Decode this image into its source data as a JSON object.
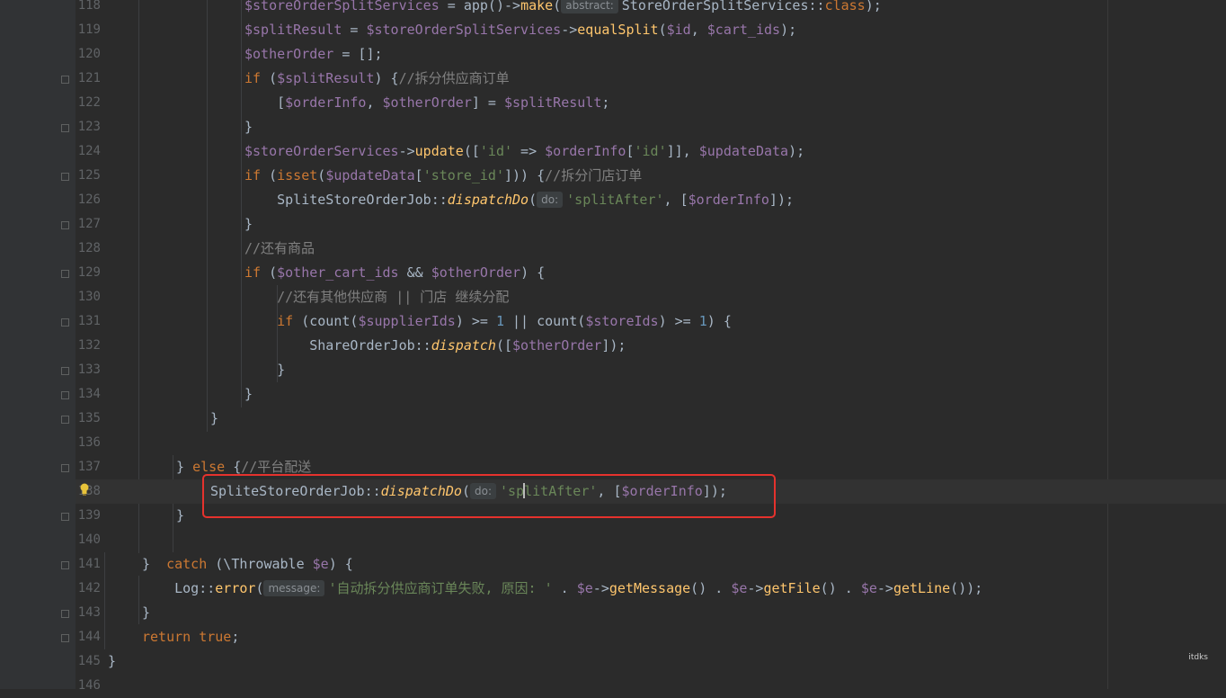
{
  "editor": {
    "lines": [
      {
        "n": "118",
        "segments": [
          [
            "var",
            "$storeOrderSplitServices"
          ],
          [
            "p",
            " = app()->"
          ],
          [
            "fn",
            "make"
          ],
          [
            "p",
            "("
          ],
          [
            "hint",
            "abstract:"
          ],
          [
            "p",
            "StoreOrderSplitServices::"
          ],
          [
            "kw",
            "class"
          ],
          [
            "p",
            ");"
          ]
        ]
      },
      {
        "n": "119",
        "segments": [
          [
            "var",
            "$splitResult"
          ],
          [
            "p",
            " = "
          ],
          [
            "var",
            "$storeOrderSplitServices"
          ],
          [
            "p",
            "->"
          ],
          [
            "fn",
            "equalSplit"
          ],
          [
            "p",
            "("
          ],
          [
            "var",
            "$id"
          ],
          [
            "p",
            ", "
          ],
          [
            "var",
            "$cart_ids"
          ],
          [
            "p",
            ");"
          ]
        ]
      },
      {
        "n": "120",
        "segments": [
          [
            "var",
            "$otherOrder"
          ],
          [
            "p",
            " = [];"
          ]
        ]
      },
      {
        "n": "121",
        "segments": [
          [
            "kw",
            "if"
          ],
          [
            "p",
            " ("
          ],
          [
            "var",
            "$splitResult"
          ],
          [
            "p",
            ") {"
          ],
          [
            "cm",
            "//拆分供应商订单"
          ]
        ]
      },
      {
        "n": "122",
        "segments": [
          [
            "p",
            "    ["
          ],
          [
            "var",
            "$orderInfo"
          ],
          [
            "p",
            ", "
          ],
          [
            "var",
            "$otherOrder"
          ],
          [
            "p",
            "] = "
          ],
          [
            "var",
            "$splitResult"
          ],
          [
            "p",
            ";"
          ]
        ]
      },
      {
        "n": "123",
        "segments": [
          [
            "p",
            "}"
          ]
        ]
      },
      {
        "n": "124",
        "segments": [
          [
            "var",
            "$storeOrderServices"
          ],
          [
            "p",
            "->"
          ],
          [
            "fn",
            "update"
          ],
          [
            "p",
            "(["
          ],
          [
            "str",
            "'id'"
          ],
          [
            "p",
            " => "
          ],
          [
            "var",
            "$orderInfo"
          ],
          [
            "p",
            "["
          ],
          [
            "str",
            "'id'"
          ],
          [
            "p",
            "]], "
          ],
          [
            "var",
            "$updateData"
          ],
          [
            "p",
            ");"
          ]
        ]
      },
      {
        "n": "125",
        "segments": [
          [
            "kw",
            "if"
          ],
          [
            "p",
            " ("
          ],
          [
            "kw",
            "isset"
          ],
          [
            "p",
            "("
          ],
          [
            "var",
            "$updateData"
          ],
          [
            "p",
            "["
          ],
          [
            "str",
            "'store_id'"
          ],
          [
            "p",
            "])) {"
          ],
          [
            "cm",
            "//拆分门店订单"
          ]
        ]
      },
      {
        "n": "126",
        "segments": [
          [
            "p",
            "    SpliteStoreOrderJob::"
          ],
          [
            "sfn",
            "dispatchDo"
          ],
          [
            "p",
            "("
          ],
          [
            "hint",
            "do:"
          ],
          [
            "str",
            "'splitAfter'"
          ],
          [
            "p",
            ", ["
          ],
          [
            "var",
            "$orderInfo"
          ],
          [
            "p",
            "]);"
          ]
        ]
      },
      {
        "n": "127",
        "segments": [
          [
            "p",
            "}"
          ]
        ]
      },
      {
        "n": "128",
        "segments": [
          [
            "cm",
            "//还有商品"
          ]
        ]
      },
      {
        "n": "129",
        "segments": [
          [
            "kw",
            "if"
          ],
          [
            "p",
            " ("
          ],
          [
            "var",
            "$other_cart_ids"
          ],
          [
            "p",
            " && "
          ],
          [
            "var",
            "$otherOrder"
          ],
          [
            "p",
            ") {"
          ]
        ]
      },
      {
        "n": "130",
        "segments": [
          [
            "cm",
            "    //还有其他供应商 || 门店 继续分配"
          ]
        ]
      },
      {
        "n": "131",
        "segments": [
          [
            "p",
            "    "
          ],
          [
            "kw",
            "if"
          ],
          [
            "p",
            " (count("
          ],
          [
            "var",
            "$supplierIds"
          ],
          [
            "p",
            ") >= "
          ],
          [
            "num",
            "1"
          ],
          [
            "p",
            " || count("
          ],
          [
            "var",
            "$storeIds"
          ],
          [
            "p",
            ") >= "
          ],
          [
            "num",
            "1"
          ],
          [
            "p",
            ") {"
          ]
        ]
      },
      {
        "n": "132",
        "segments": [
          [
            "p",
            "        ShareOrderJob::"
          ],
          [
            "sfn",
            "dispatch"
          ],
          [
            "p",
            "(["
          ],
          [
            "var",
            "$otherOrder"
          ],
          [
            "p",
            "]);"
          ]
        ]
      },
      {
        "n": "133",
        "segments": [
          [
            "p",
            "    }"
          ]
        ]
      },
      {
        "n": "134",
        "segments": [
          [
            "p",
            "}"
          ]
        ]
      },
      {
        "n": "135",
        "segments": [
          [
            "p",
            "}"
          ]
        ]
      },
      {
        "n": "136",
        "segments": []
      },
      {
        "n": "137",
        "segments": [
          [
            "p",
            "} "
          ],
          [
            "kw",
            "else"
          ],
          [
            "p",
            " {"
          ],
          [
            "cm",
            "//平台配送"
          ]
        ]
      },
      {
        "n": "138",
        "segments": [
          [
            "p",
            "SpliteStoreOrderJob::"
          ],
          [
            "sfn",
            "dispatchDo"
          ],
          [
            "p",
            "("
          ],
          [
            "hint",
            "do:"
          ],
          [
            "str",
            "'sp"
          ],
          [
            "caret",
            ""
          ],
          [
            "str",
            "litAfter'"
          ],
          [
            "p",
            ", ["
          ],
          [
            "var",
            "$orderInfo"
          ],
          [
            "p",
            "]);"
          ]
        ]
      },
      {
        "n": "139",
        "segments": [
          [
            "p",
            "}"
          ]
        ]
      },
      {
        "n": "140",
        "segments": []
      },
      {
        "n": "141",
        "segments": [
          [
            "p",
            "}  "
          ],
          [
            "kw",
            "catch"
          ],
          [
            "p",
            " (\\Throwable "
          ],
          [
            "var",
            "$e"
          ],
          [
            "p",
            ") {"
          ]
        ]
      },
      {
        "n": "142",
        "segments": [
          [
            "p",
            "    Log::"
          ],
          [
            "fn",
            "error"
          ],
          [
            "p",
            "("
          ],
          [
            "hint",
            "message:"
          ],
          [
            "str",
            "'自动拆分供应商订单失败, 原因: '"
          ],
          [
            "p",
            " . "
          ],
          [
            "var",
            "$e"
          ],
          [
            "p",
            "->"
          ],
          [
            "fn",
            "getMessage"
          ],
          [
            "p",
            "() . "
          ],
          [
            "var",
            "$e"
          ],
          [
            "p",
            "->"
          ],
          [
            "fn",
            "getFile"
          ],
          [
            "p",
            "() . "
          ],
          [
            "var",
            "$e"
          ],
          [
            "p",
            "->"
          ],
          [
            "fn",
            "getLine"
          ],
          [
            "p",
            "());"
          ]
        ]
      },
      {
        "n": "143",
        "segments": [
          [
            "p",
            "}"
          ]
        ]
      },
      {
        "n": "144",
        "segments": [
          [
            "kw",
            "return true"
          ],
          [
            "p",
            ";"
          ]
        ]
      },
      {
        "n": "145",
        "segments": [
          [
            "p",
            "}"
          ]
        ]
      },
      {
        "n": "146",
        "segments": []
      }
    ]
  },
  "colors": {
    "accent": "#e5322d",
    "background": "#2b2b2b"
  },
  "watermark": "itdks"
}
